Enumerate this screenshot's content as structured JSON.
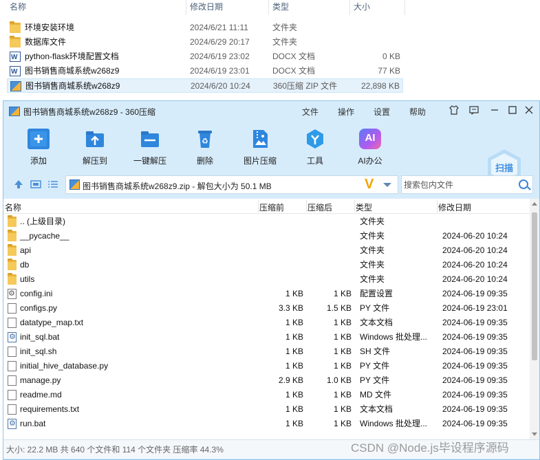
{
  "explorer": {
    "headers": {
      "name": "名称",
      "date": "修改日期",
      "type": "类型",
      "size": "大小"
    },
    "rows": [
      {
        "icon": "folder-icon",
        "name": "环境安装环境",
        "date": "2024/6/21 11:11",
        "type": "文件夹",
        "size": ""
      },
      {
        "icon": "folder-icon",
        "name": "数据库文件",
        "date": "2024/6/29 20:17",
        "type": "文件夹",
        "size": ""
      },
      {
        "icon": "docx-icon",
        "name": "python-flask环境配置文档",
        "date": "2024/6/19 23:02",
        "type": "DOCX 文档",
        "size": "0 KB"
      },
      {
        "icon": "docx-icon",
        "name": "图书销售商城系统w268z9",
        "date": "2024/6/19 23:01",
        "type": "DOCX 文档",
        "size": "77 KB"
      },
      {
        "icon": "zip-icon",
        "name": "图书销售商城系统w268z9",
        "date": "2024/6/20 10:24",
        "type": "360压缩 ZIP 文件",
        "size": "22,898 KB"
      }
    ]
  },
  "window": {
    "title": "图书销售商城系统w268z9 - 360压缩",
    "menu": [
      "文件",
      "操作",
      "设置",
      "帮助"
    ],
    "toolbar": [
      "添加",
      "解压到",
      "一键解压",
      "删除",
      "图片压缩",
      "工具",
      "AI办公"
    ],
    "ai_badge": "AI",
    "scan_label": "扫描",
    "path": "图书销售商城系统w268z9.zip - 解包大小为 50.1 MB",
    "path_badge": "V",
    "search_placeholder": "搜索包内文件",
    "columns": {
      "name": "名称",
      "before": "压缩前",
      "after": "压缩后",
      "type": "类型",
      "date": "修改日期"
    },
    "files": [
      {
        "icon": "folder-icon",
        "name": ".. (上级目录)",
        "before": "",
        "after": "",
        "type": "文件夹",
        "date": ""
      },
      {
        "icon": "folder-icon",
        "name": "__pycache__",
        "before": "",
        "after": "",
        "type": "文件夹",
        "date": "2024-06-20 10:24"
      },
      {
        "icon": "folder-icon",
        "name": "api",
        "before": "",
        "after": "",
        "type": "文件夹",
        "date": "2024-06-20 10:24"
      },
      {
        "icon": "folder-icon",
        "name": "db",
        "before": "",
        "after": "",
        "type": "文件夹",
        "date": "2024-06-20 10:24"
      },
      {
        "icon": "folder-icon",
        "name": "utils",
        "before": "",
        "after": "",
        "type": "文件夹",
        "date": "2024-06-20 10:24"
      },
      {
        "icon": "config-file-icon",
        "name": "config.ini",
        "before": "1 KB",
        "after": "1 KB",
        "type": "配置设置",
        "date": "2024-06-19 09:35"
      },
      {
        "icon": "file-icon",
        "name": "configs.py",
        "before": "3.3 KB",
        "after": "1.5 KB",
        "type": "PY 文件",
        "date": "2024-06-19 23:01"
      },
      {
        "icon": "file-icon",
        "name": "datatype_map.txt",
        "before": "1 KB",
        "after": "1 KB",
        "type": "文本文档",
        "date": "2024-06-19 09:35"
      },
      {
        "icon": "batch-file-icon",
        "name": "init_sql.bat",
        "before": "1 KB",
        "after": "1 KB",
        "type": "Windows 批处理...",
        "date": "2024-06-19 09:35"
      },
      {
        "icon": "file-icon",
        "name": "init_sql.sh",
        "before": "1 KB",
        "after": "1 KB",
        "type": "SH 文件",
        "date": "2024-06-19 09:35"
      },
      {
        "icon": "file-icon",
        "name": "initial_hive_database.py",
        "before": "1 KB",
        "after": "1 KB",
        "type": "PY 文件",
        "date": "2024-06-19 09:35"
      },
      {
        "icon": "file-icon",
        "name": "manage.py",
        "before": "2.9 KB",
        "after": "1.0 KB",
        "type": "PY 文件",
        "date": "2024-06-19 09:35"
      },
      {
        "icon": "file-icon",
        "name": "readme.md",
        "before": "1 KB",
        "after": "1 KB",
        "type": "MD 文件",
        "date": "2024-06-19 09:35"
      },
      {
        "icon": "file-icon",
        "name": "requirements.txt",
        "before": "1 KB",
        "after": "1 KB",
        "type": "文本文档",
        "date": "2024-06-19 09:35"
      },
      {
        "icon": "batch-file-icon",
        "name": "run.bat",
        "before": "1 KB",
        "after": "1 KB",
        "type": "Windows 批处理...",
        "date": "2024-06-19 09:35"
      }
    ],
    "status": "大小: 22.2 MB 共 640 个文件和 114 个文件夹 压缩率 44.3%"
  },
  "watermark": "CSDN @Node.js毕设程序源码",
  "colors": {
    "window_bg": "#d7ecfb",
    "accent": "#3a84d6",
    "folder": "#f5c95a"
  }
}
